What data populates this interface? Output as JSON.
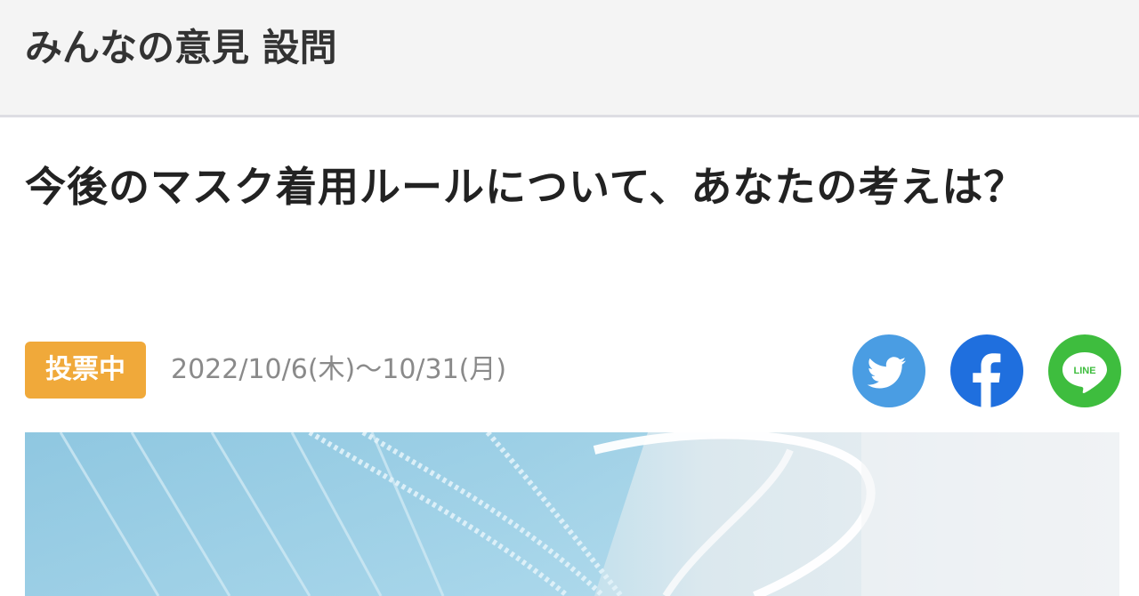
{
  "header": {
    "title": "みんなの意見 設問"
  },
  "question": {
    "title": "今後のマスク着用ルールについて、あなたの考えは？",
    "status_badge": "投票中",
    "date_range": "2022/10/6(木)〜10/31(月)"
  },
  "share": {
    "twitter_icon": "twitter-bird-icon",
    "facebook_icon": "facebook-f-icon",
    "line_icon": "line-icon",
    "line_label": "LINE",
    "colors": {
      "twitter": "#4a9de3",
      "facebook": "#1f6fde",
      "line": "#3ebd3e"
    }
  },
  "colors": {
    "badge": "#f0a93a",
    "header_bg": "#f4f4f4"
  }
}
